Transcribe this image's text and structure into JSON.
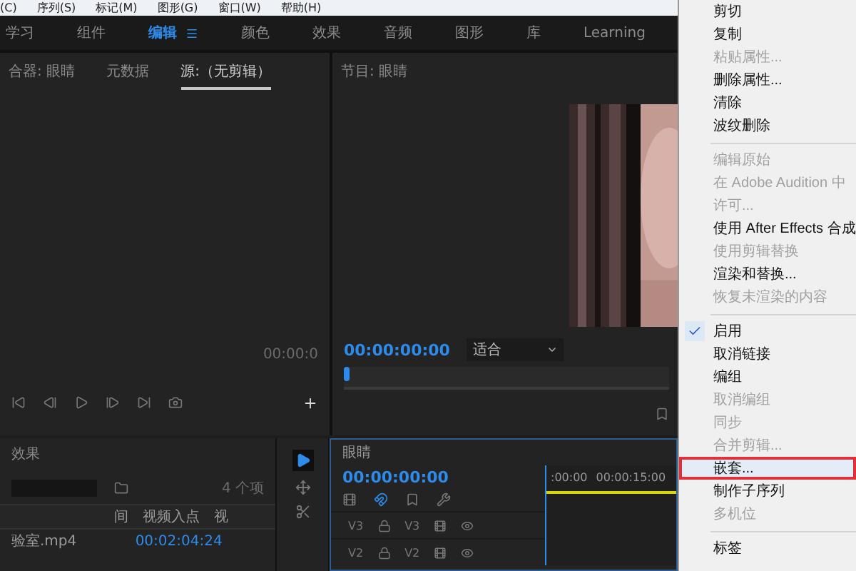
{
  "menubar": [
    "(C)",
    "序列(S)",
    "标记(M)",
    "图形(G)",
    "窗口(W)",
    "帮助(H)"
  ],
  "workspaces": [
    {
      "label": "学习",
      "selected": false
    },
    {
      "label": "组件",
      "selected": false
    },
    {
      "label": "编辑",
      "selected": true
    },
    {
      "label": "颜色",
      "selected": false
    },
    {
      "label": "效果",
      "selected": false
    },
    {
      "label": "音频",
      "selected": false
    },
    {
      "label": "图形",
      "selected": false
    },
    {
      "label": "库",
      "selected": false
    },
    {
      "label": "Learning",
      "selected": false
    }
  ],
  "source_panel": {
    "tabs": [
      {
        "label": "合器: 眼睛",
        "selected": false
      },
      {
        "label": "元数据",
        "selected": false
      },
      {
        "label": "源:（无剪辑）",
        "selected": true
      }
    ],
    "timecode": "00:00:0"
  },
  "program_panel": {
    "title": "节目: 眼睛",
    "timecode": "00:00:00:00",
    "fit": "适合"
  },
  "project_panel": {
    "tab": "效果",
    "item_count": "4 个项",
    "columns": [
      "间",
      "视频入点",
      "视"
    ],
    "rows": [
      {
        "name": "验室.mp4",
        "in_point": "00:02:04:24"
      }
    ]
  },
  "timeline": {
    "title": "眼睛",
    "timecode": "00:00:00:00",
    "ruler": [
      ":00:00",
      "00:00:15:00"
    ],
    "tracks": [
      {
        "label": "V3",
        "target": "V3"
      },
      {
        "label": "V2",
        "target": "V2"
      }
    ]
  },
  "context_menu": {
    "items": [
      {
        "kind": "item",
        "label": "剪切",
        "disabled": false,
        "checked": false,
        "highlighted": false
      },
      {
        "kind": "item",
        "label": "复制",
        "disabled": false,
        "checked": false,
        "highlighted": false
      },
      {
        "kind": "item",
        "label": "粘贴属性...",
        "disabled": true,
        "checked": false,
        "highlighted": false
      },
      {
        "kind": "item",
        "label": "删除属性...",
        "disabled": false,
        "checked": false,
        "highlighted": false
      },
      {
        "kind": "item",
        "label": "清除",
        "disabled": false,
        "checked": false,
        "highlighted": false
      },
      {
        "kind": "item",
        "label": "波纹删除",
        "disabled": false,
        "checked": false,
        "highlighted": false
      },
      {
        "kind": "separator"
      },
      {
        "kind": "item",
        "label": "编辑原始",
        "disabled": true,
        "checked": false,
        "highlighted": false
      },
      {
        "kind": "item",
        "label": "在 Adobe Audition 中",
        "disabled": true,
        "checked": false,
        "highlighted": false
      },
      {
        "kind": "item",
        "label": "许可...",
        "disabled": true,
        "checked": false,
        "highlighted": false
      },
      {
        "kind": "item",
        "label": "使用 After Effects 合成",
        "disabled": false,
        "checked": false,
        "highlighted": false
      },
      {
        "kind": "item",
        "label": "使用剪辑替换",
        "disabled": true,
        "checked": false,
        "highlighted": false
      },
      {
        "kind": "item",
        "label": "渲染和替换...",
        "disabled": false,
        "checked": false,
        "highlighted": false
      },
      {
        "kind": "item",
        "label": "恢复未渲染的内容",
        "disabled": true,
        "checked": false,
        "highlighted": false
      },
      {
        "kind": "separator"
      },
      {
        "kind": "item",
        "label": "启用",
        "disabled": false,
        "checked": true,
        "highlighted": false
      },
      {
        "kind": "item",
        "label": "取消链接",
        "disabled": false,
        "checked": false,
        "highlighted": false
      },
      {
        "kind": "item",
        "label": "编组",
        "disabled": false,
        "checked": false,
        "highlighted": false
      },
      {
        "kind": "item",
        "label": "取消编组",
        "disabled": true,
        "checked": false,
        "highlighted": false
      },
      {
        "kind": "item",
        "label": "同步",
        "disabled": true,
        "checked": false,
        "highlighted": false
      },
      {
        "kind": "item",
        "label": "合并剪辑...",
        "disabled": true,
        "checked": false,
        "highlighted": false
      },
      {
        "kind": "item",
        "label": "嵌套...",
        "disabled": false,
        "checked": false,
        "highlighted": true
      },
      {
        "kind": "item",
        "label": "制作子序列",
        "disabled": false,
        "checked": false,
        "highlighted": false
      },
      {
        "kind": "item",
        "label": "多机位",
        "disabled": true,
        "checked": false,
        "highlighted": false
      },
      {
        "kind": "separator"
      },
      {
        "kind": "item",
        "label": "标签",
        "disabled": false,
        "checked": false,
        "highlighted": false
      }
    ]
  }
}
